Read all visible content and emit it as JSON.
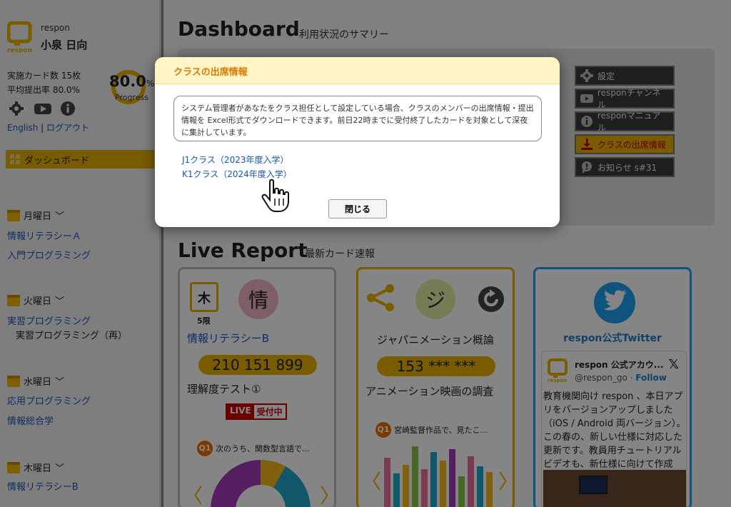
{
  "sidebar": {
    "brand_small": "respon",
    "logo_text": "respon",
    "user_name": "小泉 日向",
    "stat_cards": "実施カード数 15枚",
    "stat_rate": "平均提出率 80.0%",
    "progress_value": "80.0",
    "progress_unit": "%",
    "progress_label": "Progress",
    "lang_label": "English",
    "separator": "|",
    "logout_label": "ログアウト",
    "dashboard_label": "ダッシュボード",
    "days": [
      {
        "label": "月曜日",
        "courses": [
          "情報リテラシーＡ",
          "入門プログラミング"
        ]
      },
      {
        "label": "火曜日",
        "courses": [
          "実習プログラミング"
        ],
        "sub_courses": [
          "実習プログラミング（再）"
        ]
      },
      {
        "label": "水曜日",
        "courses": [
          "応用プログラミング",
          "情報総合学"
        ]
      },
      {
        "label": "木曜日",
        "courses": [
          "情報リテラシーB"
        ]
      }
    ]
  },
  "main": {
    "title": "Dashboard",
    "subtitle": "利用状況のサマリー",
    "right_buttons": [
      {
        "label": "設定",
        "icon": "gear-icon"
      },
      {
        "label": "responチャンネル",
        "icon": "youtube-icon"
      },
      {
        "label": "responマニュアル",
        "icon": "info-icon"
      },
      {
        "label": "クラスの出席情報",
        "icon": "download-icon",
        "active": true
      },
      {
        "label": "お知らせ s#31",
        "icon": "chat-icon"
      }
    ],
    "live_title": "Live Report",
    "live_subtitle": "最新カード速報"
  },
  "cards": [
    {
      "weekday_char": "木",
      "period": "5限",
      "subject_char": "情",
      "course": "情報リテラシーB",
      "code": "210 151 899",
      "card_title": "理解度テスト①",
      "live_left": "LIVE",
      "live_right": "受付中",
      "q_badge": "Q1",
      "q_text": "次のうち、関数型言語で..."
    },
    {
      "subject_char": "ジ",
      "course": "ジャパニメーション概論",
      "code": "153 *** ***",
      "card_title": "アニメーション映画の調査",
      "q_badge": "Q1",
      "q_text": "宮崎監督作品で、見たこ..."
    },
    {
      "title": "respon公式Twitter",
      "tweet_name": "respon 公式アカウ...",
      "tweet_handle": "@respon_go",
      "tweet_dot": " · ",
      "tweet_follow": "Follow",
      "tweet_x": "𝕏",
      "tweet_body": "教育機関向け respon 、本日アプリをバージョンアップしました（iOS / Android 両バージョン）。この春の、新しい仕様に対応した更新です。教員用チュートリアルビデオも、新仕様に向けて作成中！"
    }
  ],
  "modal": {
    "title": "クラスの出席情報",
    "description": "システム管理者があなたをクラス担任として設定している場合、クラスのメンバーの出席情報・提出情報を Excel形式でダウンロードできます。前日22時までに受付終了したカードを対象として深夜に集計しています。",
    "classes": [
      "J1クラス（2023年度入学）",
      "K1クラス（2024年度入学）"
    ],
    "close_label": "閉じる"
  },
  "colors": {
    "accent": "#e8b100",
    "link": "#1a55b8",
    "modal_title": "#e07800",
    "twitter": "#1da1f2"
  }
}
